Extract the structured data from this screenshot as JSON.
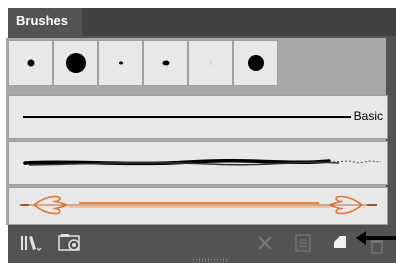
{
  "panel": {
    "tab_label": "Brushes"
  },
  "brush_dots": [
    {
      "name": "dot-small",
      "size": 7
    },
    {
      "name": "dot-large",
      "size": 20
    },
    {
      "name": "dot-tiny-tapered",
      "size": 4
    },
    {
      "name": "dot-small-oval",
      "size": 6
    },
    {
      "name": "dot-hairline",
      "size": 2
    },
    {
      "name": "dot-medium",
      "size": 16
    }
  ],
  "brush_rows": [
    {
      "name": "basic-stroke",
      "label": "Basic"
    },
    {
      "name": "charcoal-stroke",
      "label": ""
    },
    {
      "name": "arrow-stroke",
      "label": ""
    }
  ],
  "footer": {
    "icons": [
      "brush-libraries-icon",
      "place-brush-icon",
      "remove-stroke-icon",
      "options-icon",
      "new-brush-icon",
      "delete-icon"
    ]
  },
  "colors": {
    "panel_bg": "#535353",
    "tab_bar_bg": "#424242",
    "cell_bg": "#e8e8e8",
    "arrow_stroke": "#e07030"
  }
}
